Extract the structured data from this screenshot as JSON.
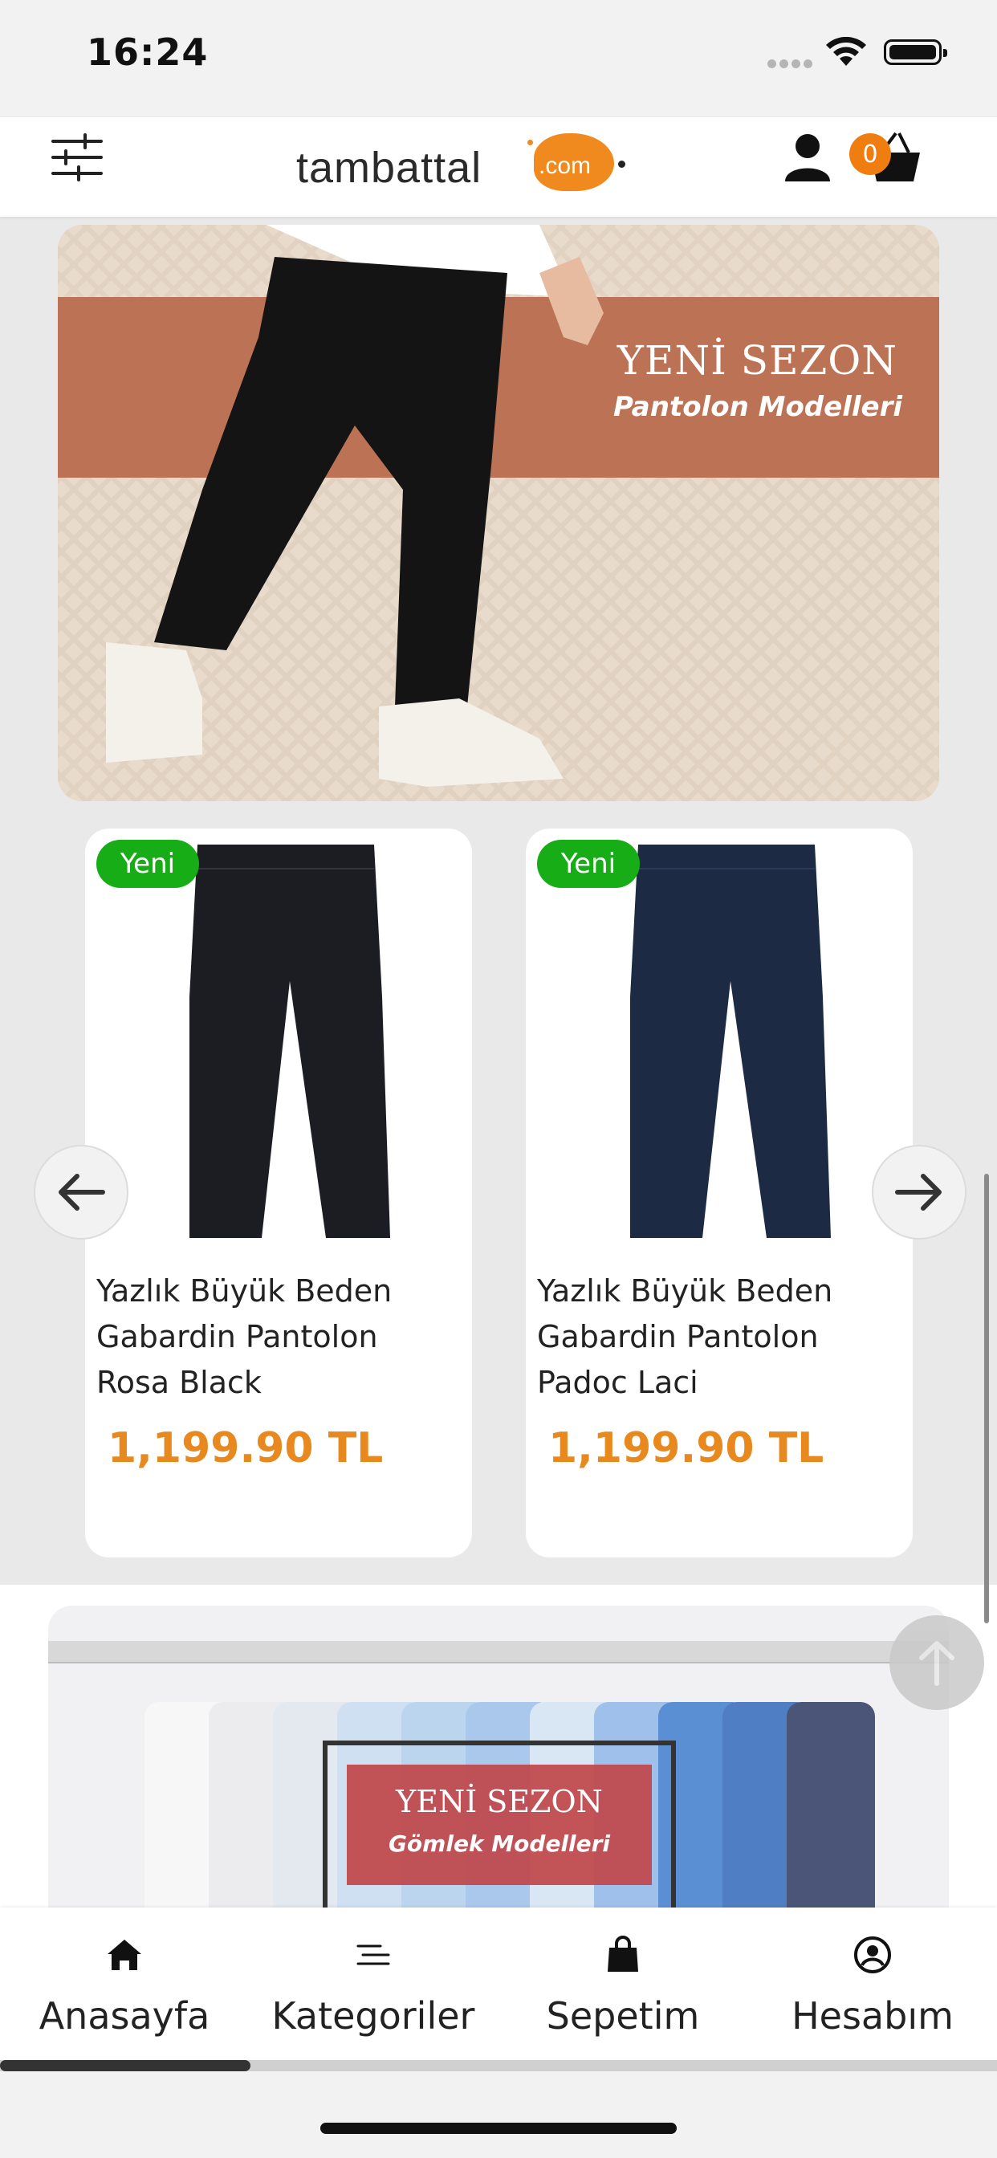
{
  "status_bar": {
    "time": "16:24"
  },
  "header": {
    "logo_text": "tambattal",
    "logo_suffix": ".com",
    "cart_count": "0"
  },
  "banner_top": {
    "title": "YENİ SEZON",
    "subtitle": "Pantolon Modelleri"
  },
  "products": [
    {
      "badge": "Yeni",
      "name": "Yazlık Büyük Beden Gabardin Pantolon Rosa Black",
      "price": "1,199.90 TL",
      "color": "#1c1d22"
    },
    {
      "badge": "Yeni",
      "name": "Yazlık Büyük Beden Gabardin Pantolon Padoc Laci",
      "price": "1,199.90 TL",
      "color": "#1d2a44"
    }
  ],
  "banner_bottom": {
    "title": "YENİ SEZON",
    "subtitle": "Gömlek Modelleri"
  },
  "bottom_nav": {
    "items": [
      {
        "label": "Anasayfa",
        "icon": "home-icon"
      },
      {
        "label": "Kategoriler",
        "icon": "list-icon"
      },
      {
        "label": "Sepetim",
        "icon": "bag-icon"
      },
      {
        "label": "Hesabım",
        "icon": "account-icon"
      }
    ]
  },
  "colors": {
    "accent": "#f07d10",
    "price": "#e8891f",
    "badge": "#17ad17"
  }
}
